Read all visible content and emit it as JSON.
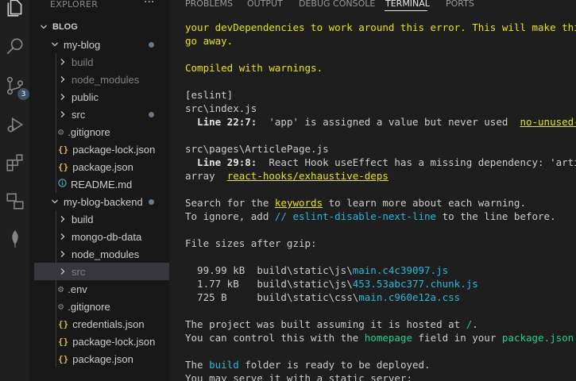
{
  "sidebar": {
    "title": "EXPLORER",
    "more": "···",
    "source_control_badge": "3",
    "tree": [
      {
        "label": "BLOG",
        "kind": "root"
      },
      {
        "label": "my-blog",
        "kind": "folder-open"
      },
      {
        "label": "build",
        "kind": "folder"
      },
      {
        "label": "node_modules",
        "kind": "folder"
      },
      {
        "label": "public",
        "kind": "folder"
      },
      {
        "label": "src",
        "kind": "folder"
      },
      {
        "label": ".gitignore",
        "kind": "file"
      },
      {
        "label": "package-lock.json",
        "kind": "file",
        "icon": "{}"
      },
      {
        "label": "package.json",
        "kind": "file",
        "icon": "{}"
      },
      {
        "label": "README.md",
        "kind": "file",
        "icon": "i"
      },
      {
        "label": "my-blog-backend",
        "kind": "folder-open"
      },
      {
        "label": "build",
        "kind": "folder"
      },
      {
        "label": "mongo-db-data",
        "kind": "folder"
      },
      {
        "label": "node_modules",
        "kind": "folder"
      },
      {
        "label": "src",
        "kind": "folder"
      },
      {
        "label": ".env",
        "kind": "file"
      },
      {
        "label": ".gitignore",
        "kind": "file"
      },
      {
        "label": "credentials.json",
        "kind": "file",
        "icon": "{}"
      },
      {
        "label": "package-lock.json",
        "kind": "file",
        "icon": "{}"
      },
      {
        "label": "package.json",
        "kind": "file",
        "icon": "{}"
      }
    ]
  },
  "panel": {
    "tabs": [
      "PROBLEMS",
      "OUTPUT",
      "DEBUG CONSOLE",
      "TERMINAL",
      "PORTS"
    ],
    "active_tab": "TERMINAL"
  },
  "terminal": {
    "l1": "your devDependencies to work around this error. This will make this message",
    "l2": "go away.",
    "l3": "Compiled with warnings.",
    "l4": "[eslint]",
    "l5": "src\\index.js",
    "l6a": "  Line 22:7:",
    "l6b": "  'app' is assigned a value but never used  ",
    "l6c": "no-unused-vars",
    "l7": "src\\pages\\ArticlePage.js",
    "l8a": "  Line 29:8:",
    "l8b": "  React Hook useEffect has a missing dependency: 'articleId'. Either include it or remove the dependency",
    "l9a": "array  ",
    "l9b": "react-hooks/exhaustive-deps",
    "l10a": "Search for the ",
    "l10b": "keywords",
    "l10c": " to learn more about each warning.",
    "l11a": "To ignore, add ",
    "l11b": "// eslint-disable-next-line",
    "l11c": " to the line before.",
    "l12": "File sizes after gzip:",
    "sizes": [
      {
        "size": "  99.99 kB  ",
        "path": "build\\static\\js\\",
        "file": "main.c4c39097.js"
      },
      {
        "size": "  1.77 kB   ",
        "path": "build\\static\\js\\",
        "file": "453.53abc377.chunk.js"
      },
      {
        "size": "  725 B     ",
        "path": "build\\static\\css\\",
        "file": "main.c960e12a.css"
      }
    ],
    "l16a": "The project was built assuming it is hosted at ",
    "l16b": "/",
    "l16c": ".",
    "l17a": "You can control this with the ",
    "l17b": "homepage",
    "l17c": " field in your ",
    "l17d": "package.json",
    "l17e": ".",
    "l18a": "The ",
    "l18b": "build",
    "l18c": " folder is ready to be deployed.",
    "l19": "You may serve it with a static server:"
  }
}
